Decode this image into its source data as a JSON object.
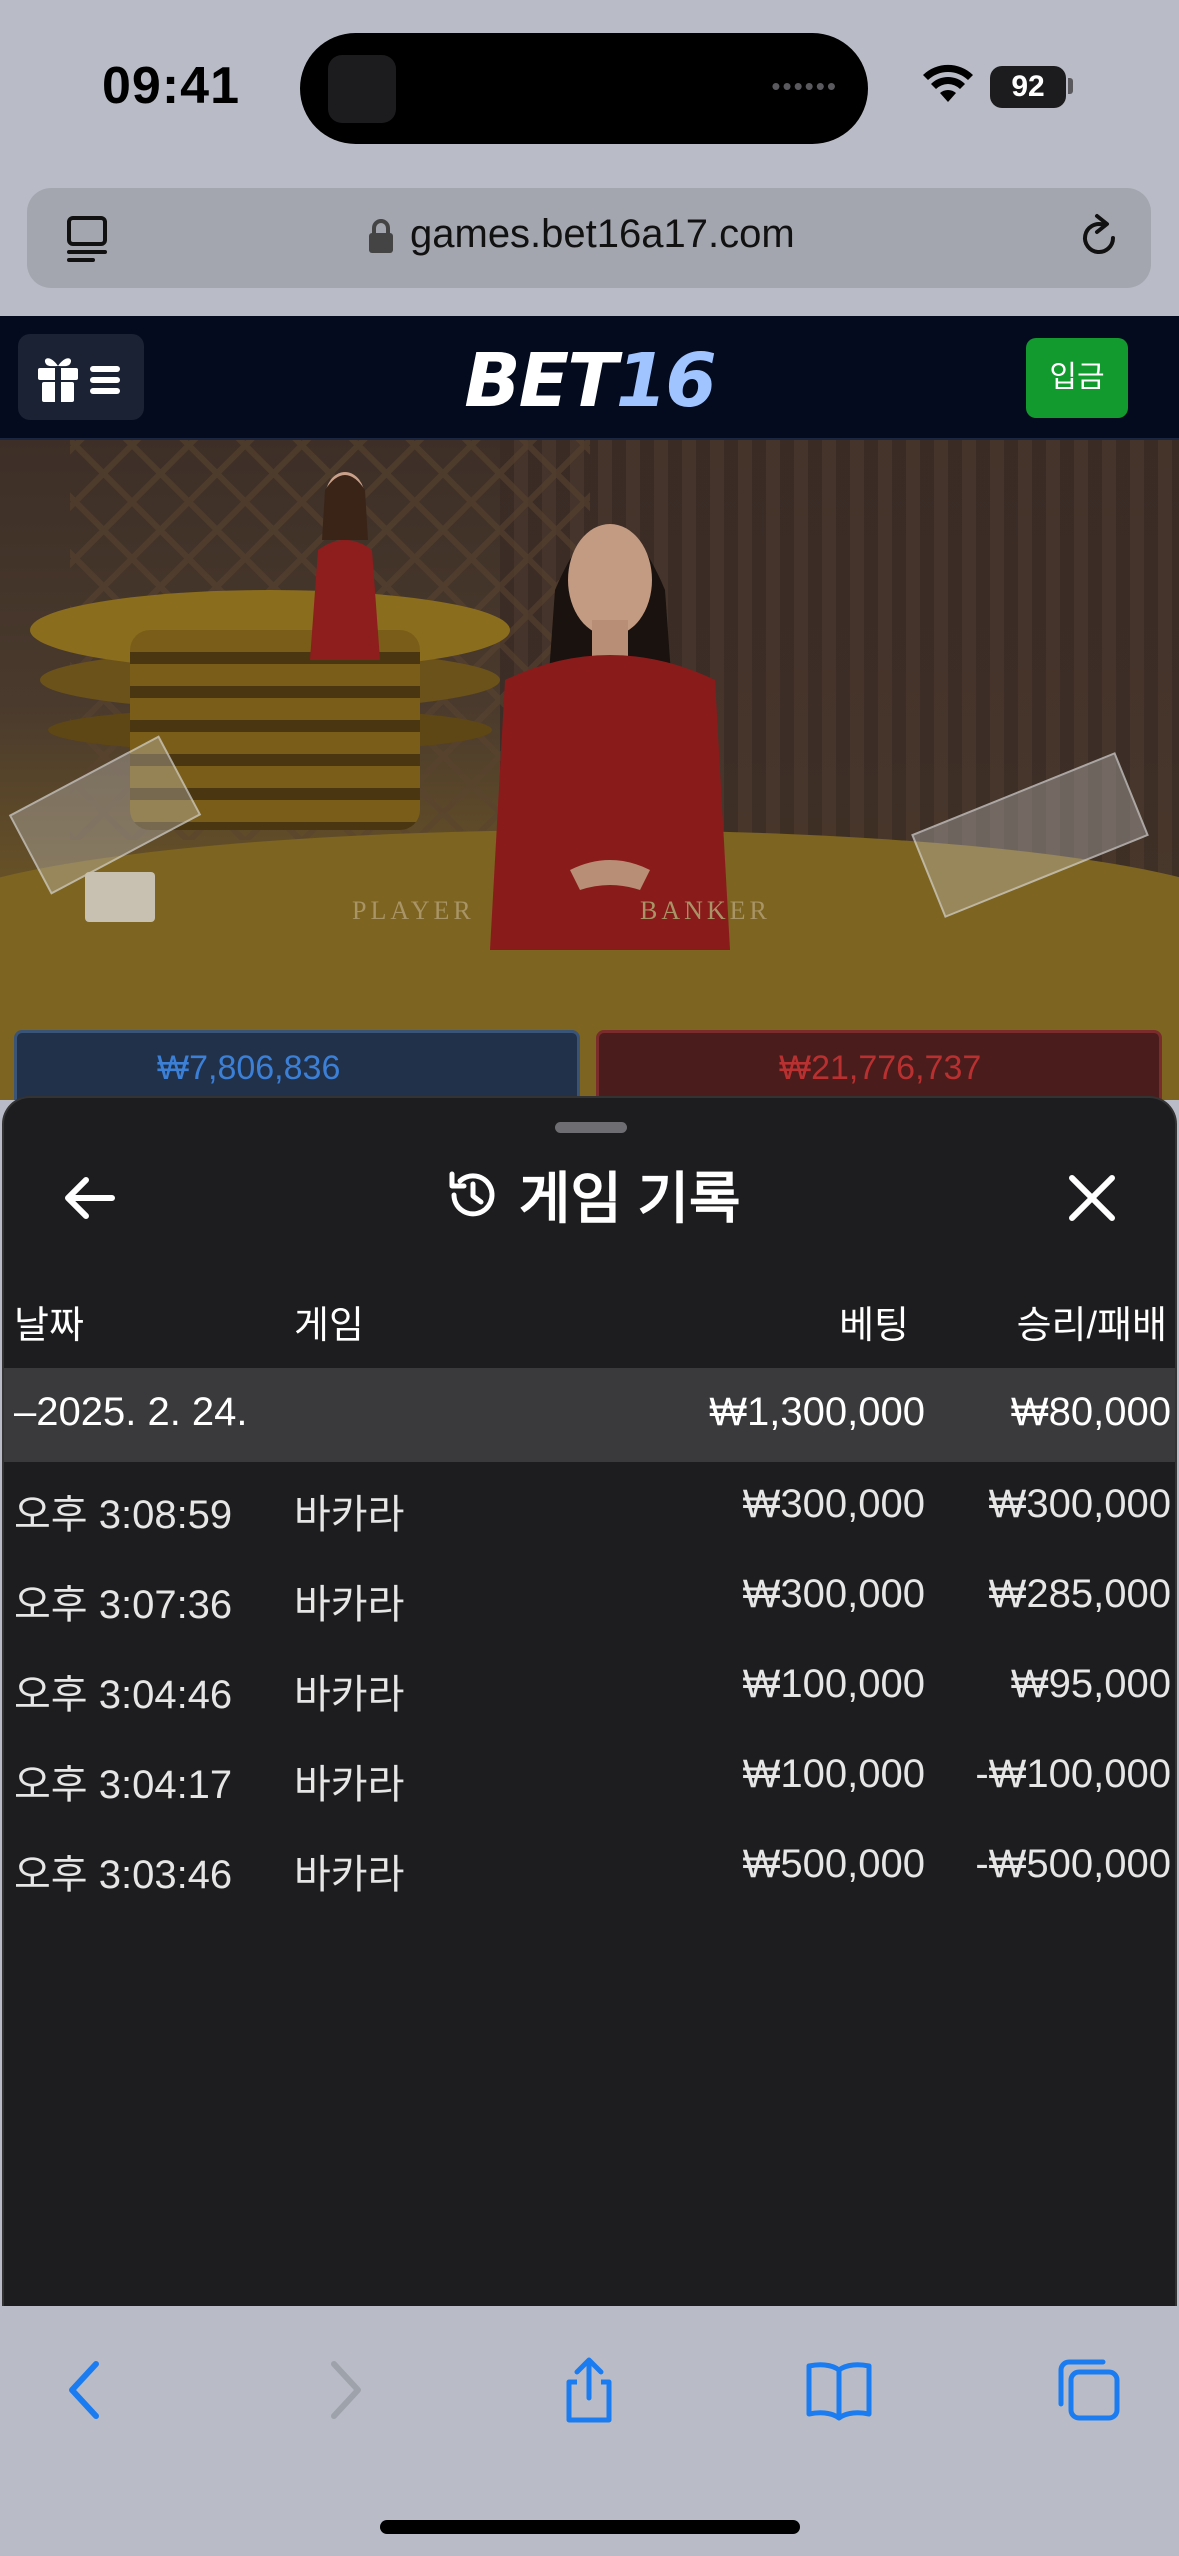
{
  "status_bar": {
    "time": "09:41",
    "battery": "92",
    "icons": [
      "wifi-icon",
      "battery-icon"
    ]
  },
  "browser": {
    "url": "games.bet16a17.com",
    "icons": [
      "tabs-icon",
      "lock-icon",
      "reload-icon"
    ]
  },
  "site_header": {
    "logo_part1": "BET",
    "logo_part2": "16",
    "deposit_label": "입금",
    "logo_color_1": "#ffffff",
    "logo_color_2": "#9fc4ff",
    "deposit_color": "#139a2e"
  },
  "game_view": {
    "felt_player": "PLAYER",
    "felt_banker": "BANKER",
    "player_bet": "₩7,806,836",
    "banker_bet": "₩21,776,737"
  },
  "history": {
    "title": "게임 기록",
    "columns": {
      "date": "날짜",
      "game": "게임",
      "bet": "베팅",
      "result": "승리/패배"
    },
    "summary": {
      "date": "–2025. 2. 24.",
      "bet": "₩1,300,000",
      "result": "₩80,000"
    },
    "rows": [
      {
        "time": "오후 3:08:59",
        "game": "바카라",
        "bet": "₩300,000",
        "result": "₩300,000"
      },
      {
        "time": "오후 3:07:36",
        "game": "바카라",
        "bet": "₩300,000",
        "result": "₩285,000"
      },
      {
        "time": "오후 3:04:46",
        "game": "바카라",
        "bet": "₩100,000",
        "result": "₩95,000"
      },
      {
        "time": "오후 3:04:17",
        "game": "바카라",
        "bet": "₩100,000",
        "result": "-₩100,000"
      },
      {
        "time": "오후 3:03:46",
        "game": "바카라",
        "bet": "₩500,000",
        "result": "-₩500,000"
      }
    ]
  },
  "toolbar": {
    "icons": [
      "back-icon",
      "forward-icon",
      "share-icon",
      "bookmarks-icon",
      "tabs-overview-icon"
    ],
    "accent": "#1b7cf2"
  }
}
